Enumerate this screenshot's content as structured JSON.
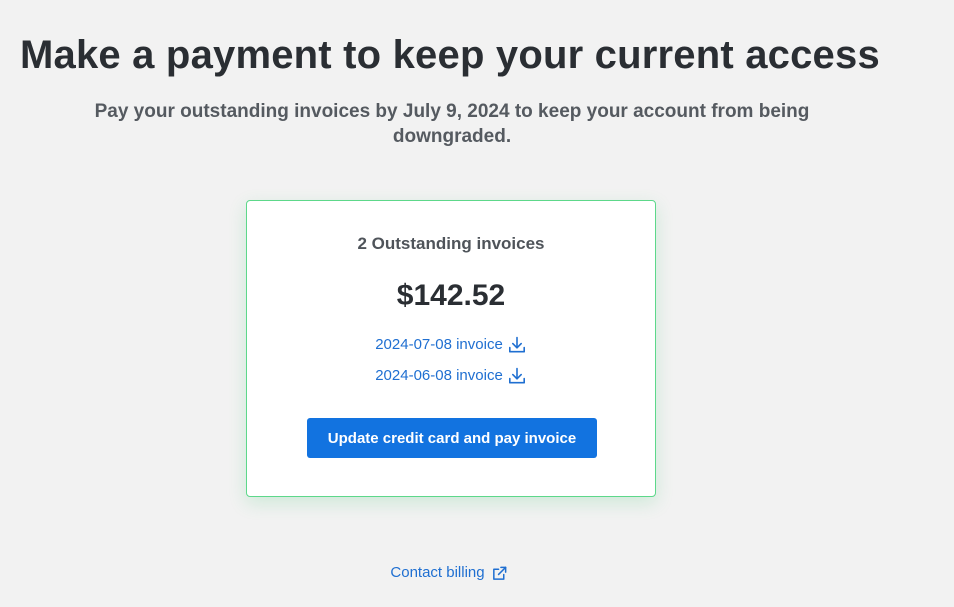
{
  "header": {
    "title": "Make a payment to keep your current access",
    "subtitle": "Pay your outstanding invoices by July 9, 2024 to keep your account from being downgraded."
  },
  "card": {
    "heading": "2 Outstanding invoices",
    "amount": "$142.52",
    "invoices": [
      {
        "label": "2024-07-08 invoice",
        "icon": "download-icon"
      },
      {
        "label": "2024-06-08 invoice",
        "icon": "download-icon"
      }
    ],
    "pay_button_label": "Update credit card and pay invoice"
  },
  "footer": {
    "contact_label": "Contact billing",
    "contact_icon": "external-link-icon"
  },
  "colors": {
    "background": "#f2f2f2",
    "card_border": "#5dd88a",
    "link": "#1f6fd1",
    "button": "#1273e0",
    "title_text": "#2a2e33",
    "subtitle_text": "#555a60"
  }
}
